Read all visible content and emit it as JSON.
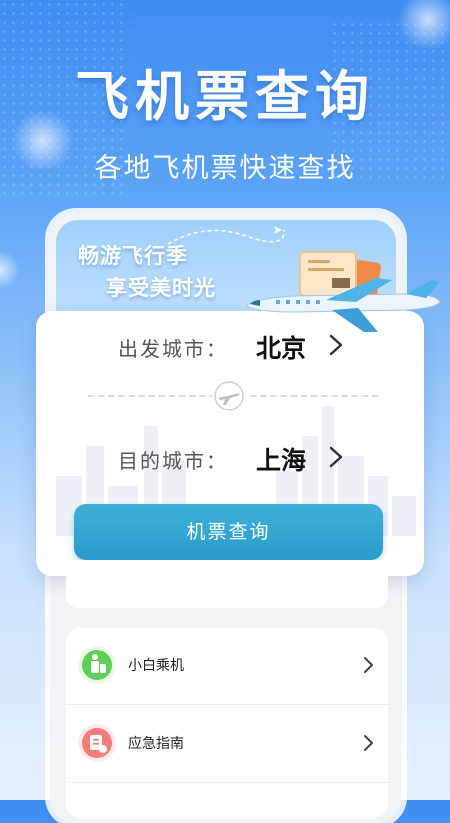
{
  "hero": {
    "title": "飞机票查询",
    "subtitle": "各地飞机票快速查找"
  },
  "banner": {
    "line1": "畅游飞行季",
    "line2": "享受美时光"
  },
  "query": {
    "departure_label": "出发城市：",
    "departure_value": "北京",
    "destination_label": "目的城市：",
    "destination_value": "上海",
    "search_button": "机票查询"
  },
  "list": {
    "items": [
      {
        "label": "小白乘机",
        "icon": "passenger-luggage-icon",
        "icon_color": "#5fcf5a"
      },
      {
        "label": "应急指南",
        "icon": "emergency-guide-icon",
        "icon_color": "#f37b7b"
      }
    ]
  },
  "colors": {
    "primary_button": "#2a9ccd",
    "background_top": "#3f8df2"
  }
}
